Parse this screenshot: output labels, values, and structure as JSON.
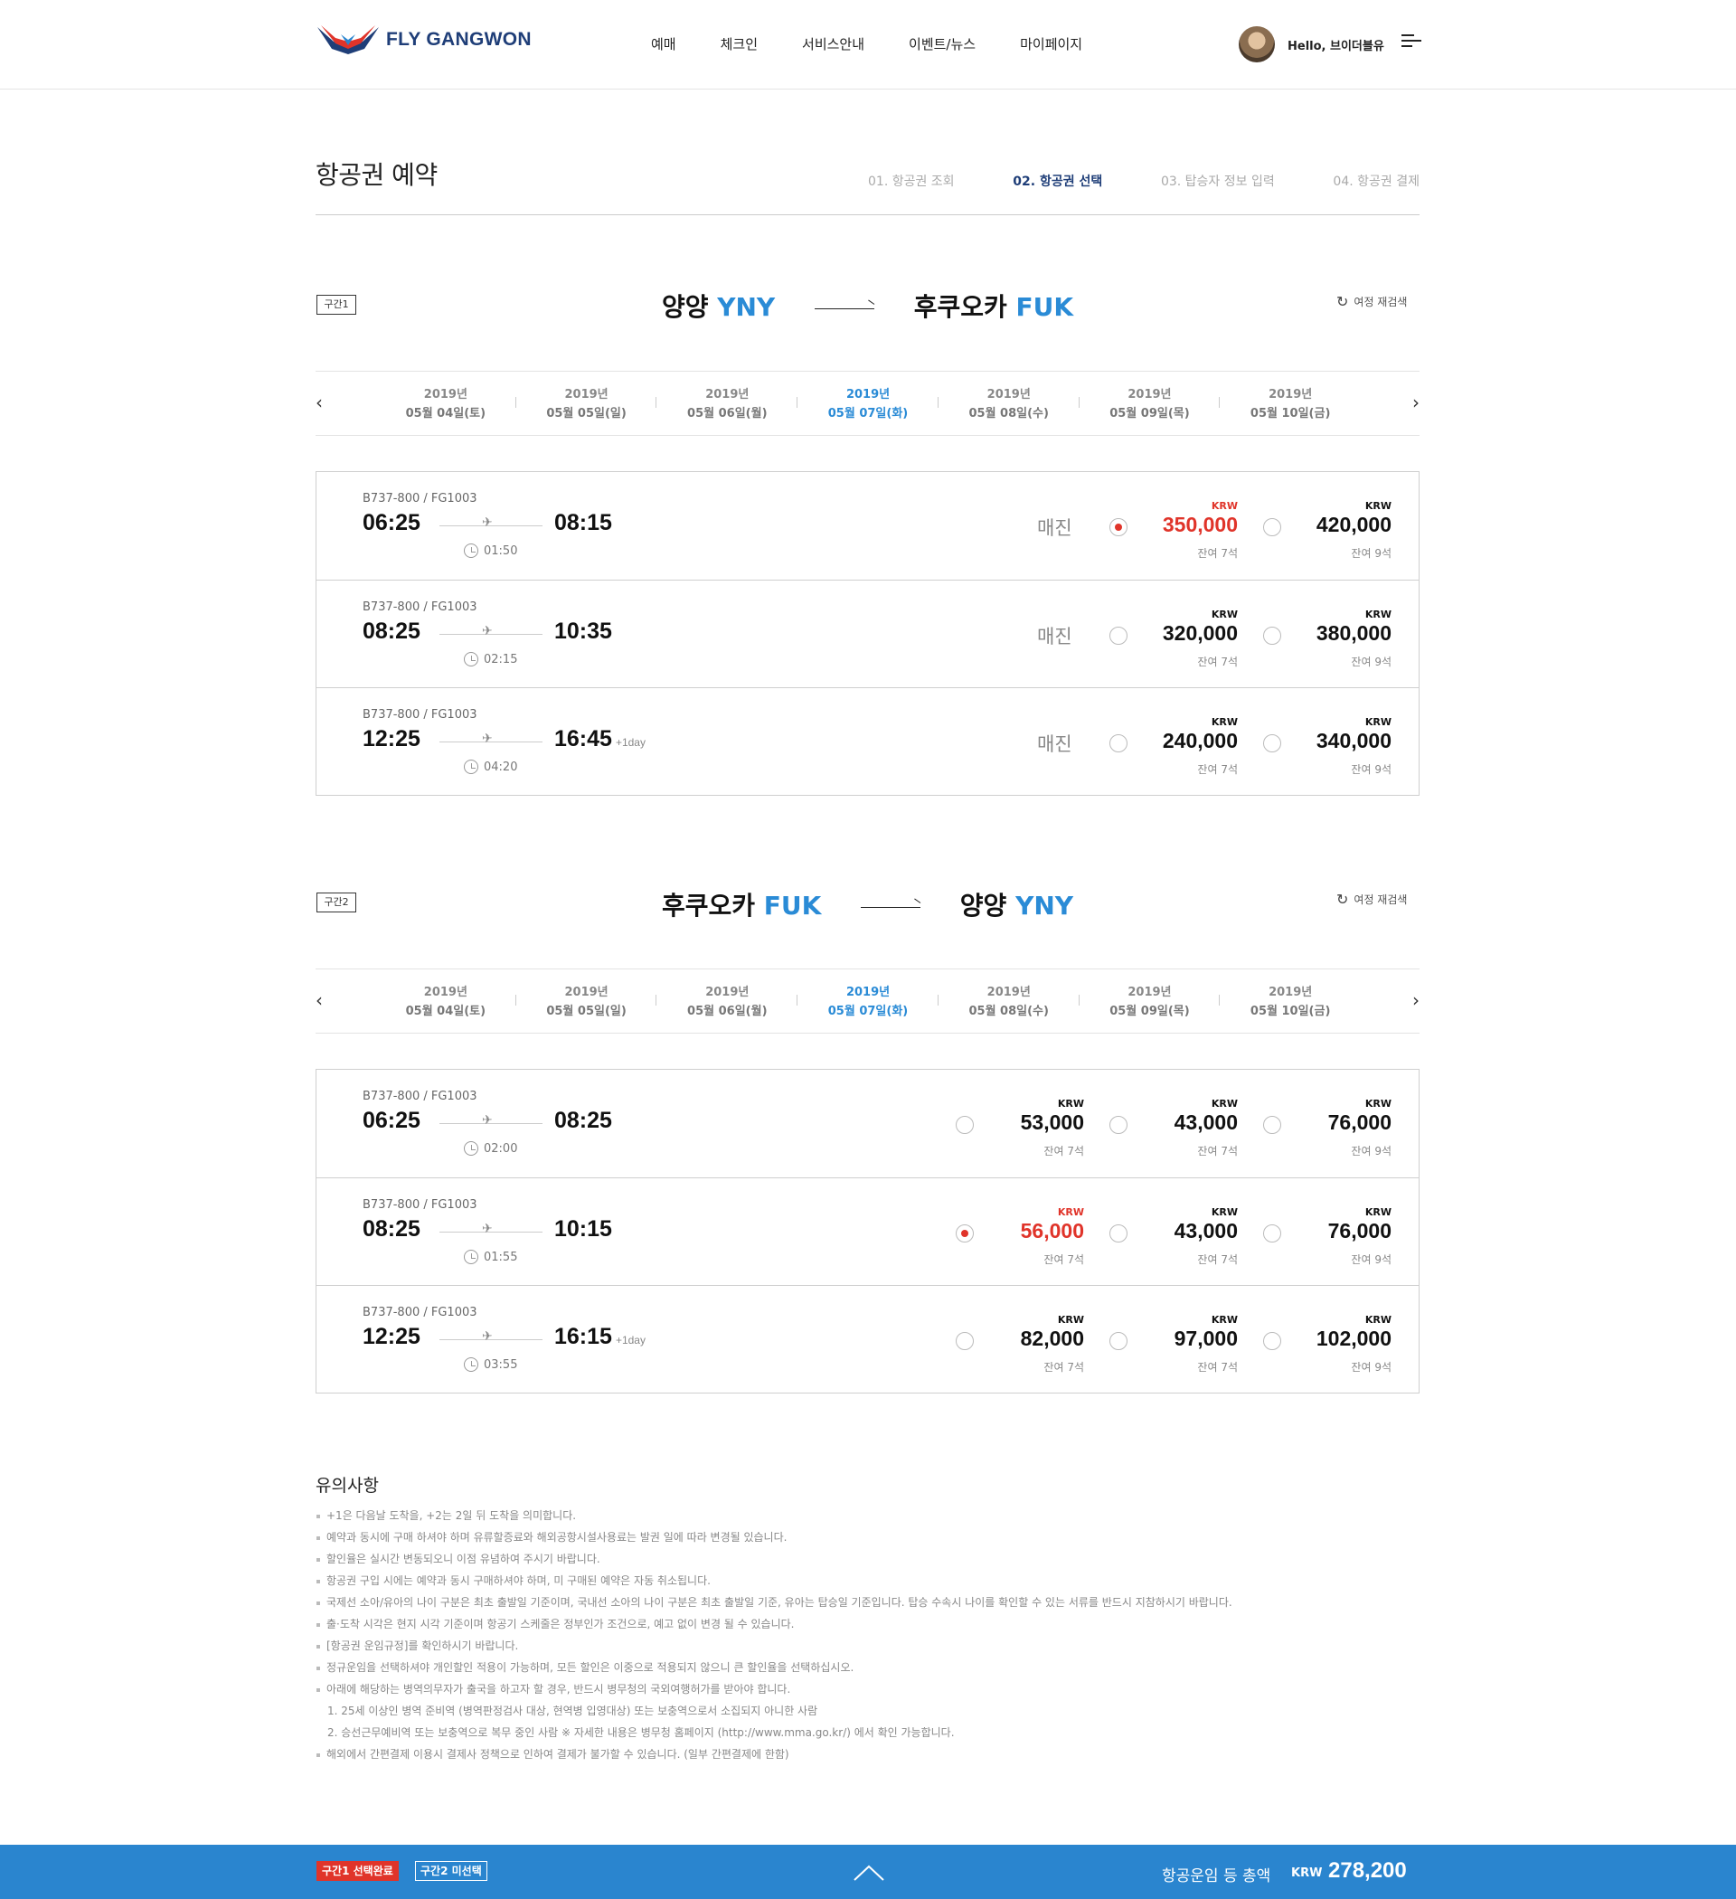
{
  "header": {
    "logo_text": "FLY GANGWON",
    "nav": [
      "예매",
      "체크인",
      "서비스안내",
      "이벤트/뉴스",
      "마이페이지"
    ],
    "greeting": "Hello, 브이더블유"
  },
  "page": {
    "title": "항공권 예약",
    "steps": [
      "01. 항공권 조회",
      "02. 항공권 선택",
      "03. 탑승자 정보 입력",
      "04. 항공권 결제"
    ],
    "active_step": "02. 항공권 선택"
  },
  "colors": {
    "brand_navy": "#1f3e78",
    "accent_blue": "#2a85cf",
    "highlight_red": "#e0342a"
  },
  "segment1": {
    "tag": "구간1",
    "from_name": "양양",
    "from_code": "YNY",
    "to_name": "후쿠오카",
    "to_code": "FUK",
    "research_label": "여정 재검색",
    "dates": [
      {
        "year": "2019년",
        "day": "05월 04일(토)"
      },
      {
        "year": "2019년",
        "day": "05월 05일(일)"
      },
      {
        "year": "2019년",
        "day": "05월 06일(월)"
      },
      {
        "year": "2019년",
        "day": "05월 07일(화)",
        "selected": true
      },
      {
        "year": "2019년",
        "day": "05월 08일(수)"
      },
      {
        "year": "2019년",
        "day": "05월 09일(목)"
      },
      {
        "year": "2019년",
        "day": "05월 10일(금)"
      }
    ],
    "flights": [
      {
        "aircraft": "B737-800 / FG1003",
        "dep": "06:25",
        "arr": "08:15",
        "plus": "",
        "duration": "01:50",
        "soldout": "매진",
        "fares": [
          {
            "cur": "KRW",
            "price": "350,000",
            "seats": "잔여 7석",
            "selected": true
          },
          {
            "cur": "KRW",
            "price": "420,000",
            "seats": "잔여 9석"
          }
        ]
      },
      {
        "aircraft": "B737-800 / FG1003",
        "dep": "08:25",
        "arr": "10:35",
        "plus": "",
        "duration": "02:15",
        "soldout": "매진",
        "fares": [
          {
            "cur": "KRW",
            "price": "320,000",
            "seats": "잔여 7석"
          },
          {
            "cur": "KRW",
            "price": "380,000",
            "seats": "잔여 9석"
          }
        ]
      },
      {
        "aircraft": "B737-800 / FG1003",
        "dep": "12:25",
        "arr": "16:45",
        "plus": "+1day",
        "duration": "04:20",
        "soldout": "매진",
        "fares": [
          {
            "cur": "KRW",
            "price": "240,000",
            "seats": "잔여 7석"
          },
          {
            "cur": "KRW",
            "price": "340,000",
            "seats": "잔여 9석"
          }
        ]
      }
    ]
  },
  "segment2": {
    "tag": "구간2",
    "from_name": "후쿠오카",
    "from_code": "FUK",
    "to_name": "양양",
    "to_code": "YNY",
    "research_label": "여정 재검색",
    "dates": [
      {
        "year": "2019년",
        "day": "05월 04일(토)"
      },
      {
        "year": "2019년",
        "day": "05월 05일(일)"
      },
      {
        "year": "2019년",
        "day": "05월 06일(월)"
      },
      {
        "year": "2019년",
        "day": "05월 07일(화)",
        "selected": true
      },
      {
        "year": "2019년",
        "day": "05월 08일(수)"
      },
      {
        "year": "2019년",
        "day": "05월 09일(목)"
      },
      {
        "year": "2019년",
        "day": "05월 10일(금)"
      }
    ],
    "flights": [
      {
        "aircraft": "B737-800 / FG1003",
        "dep": "06:25",
        "arr": "08:25",
        "plus": "",
        "duration": "02:00",
        "fares": [
          {
            "cur": "KRW",
            "price": "53,000",
            "seats": "잔여 7석"
          },
          {
            "cur": "KRW",
            "price": "43,000",
            "seats": "잔여 7석"
          },
          {
            "cur": "KRW",
            "price": "76,000",
            "seats": "잔여 9석"
          }
        ]
      },
      {
        "aircraft": "B737-800 / FG1003",
        "dep": "08:25",
        "arr": "10:15",
        "plus": "",
        "duration": "01:55",
        "fares": [
          {
            "cur": "KRW",
            "price": "56,000",
            "seats": "잔여 7석",
            "selected": true
          },
          {
            "cur": "KRW",
            "price": "43,000",
            "seats": "잔여 7석"
          },
          {
            "cur": "KRW",
            "price": "76,000",
            "seats": "잔여 9석"
          }
        ]
      },
      {
        "aircraft": "B737-800 / FG1003",
        "dep": "12:25",
        "arr": "16:15",
        "plus": "+1day",
        "duration": "03:55",
        "fares": [
          {
            "cur": "KRW",
            "price": "82,000",
            "seats": "잔여 7석"
          },
          {
            "cur": "KRW",
            "price": "97,000",
            "seats": "잔여 7석"
          },
          {
            "cur": "KRW",
            "price": "102,000",
            "seats": "잔여 9석"
          }
        ]
      }
    ]
  },
  "notice": {
    "title": "유의사항",
    "items": [
      "+1은 다음날 도착을, +2는 2일 뒤 도착을 의미합니다.",
      "예약과 동시에 구매 하셔야 하며 유류할증료와 해외공항시설사용료는 발권 일에 따라 변경될 있습니다.",
      "할인율은 실시간 변동되오니 이점 유념하여 주시기 바랍니다.",
      "항공권 구입 시에는 예약과 동시 구매하셔야 하며, 미 구매된 예약은 자동 취소됩니다.",
      "국제선 소아/유아의 나이 구분은 최초 출발일 기준이며, 국내선 소아의 나이 구분은 최초 출발일 기준, 유아는 탑승일 기준입니다. 탑승 수속시 나이를 확인할 수 있는 서류를 반드시 지참하시기 바랍니다.",
      "출·도착 시각은 현지 시각 기준이며 항공기 스케줄은 정부인가 조건으로, 예고 없이 변경 될 수 있습니다.",
      "[항공권 운임규정]를 확인하시기 바랍니다.",
      "정규운임을 선택하셔야 개인할인 적용이 가능하며, 모든 할인은 이중으로 적용되지 않으니 큰 할인율을 선택하십시오.",
      "아래에 해당하는 병역의무자가 출국을 하고자 할 경우, 반드시 병무청의 국외여행허가를 받아야 합니다."
    ],
    "sub_items": [
      "1. 25세 이상인 병역 준비역 (병역판정검사 대상, 현역병 입영대상) 또는 보충역으로서 소집되지 아니한 사람",
      "2. 승선근무예비역 또는 보충역으로 복무 중인 사람 ※ 자세한 내용은 병무청 홈페이지 (http://www.mma.go.kr/) 에서 확인 가능합니다."
    ],
    "last_item": "해외에서 간편결제 이용시 결제사 정책으로 인하여 결제가 불가할 수 있습니다. (일부 간편결제에 한함)"
  },
  "bottom": {
    "seg1_status": "구간1 선택완료",
    "seg2_status": "구간2 미선택",
    "total_label": "항공운임 등 총액",
    "currency": "KRW",
    "total": "278,200"
  }
}
